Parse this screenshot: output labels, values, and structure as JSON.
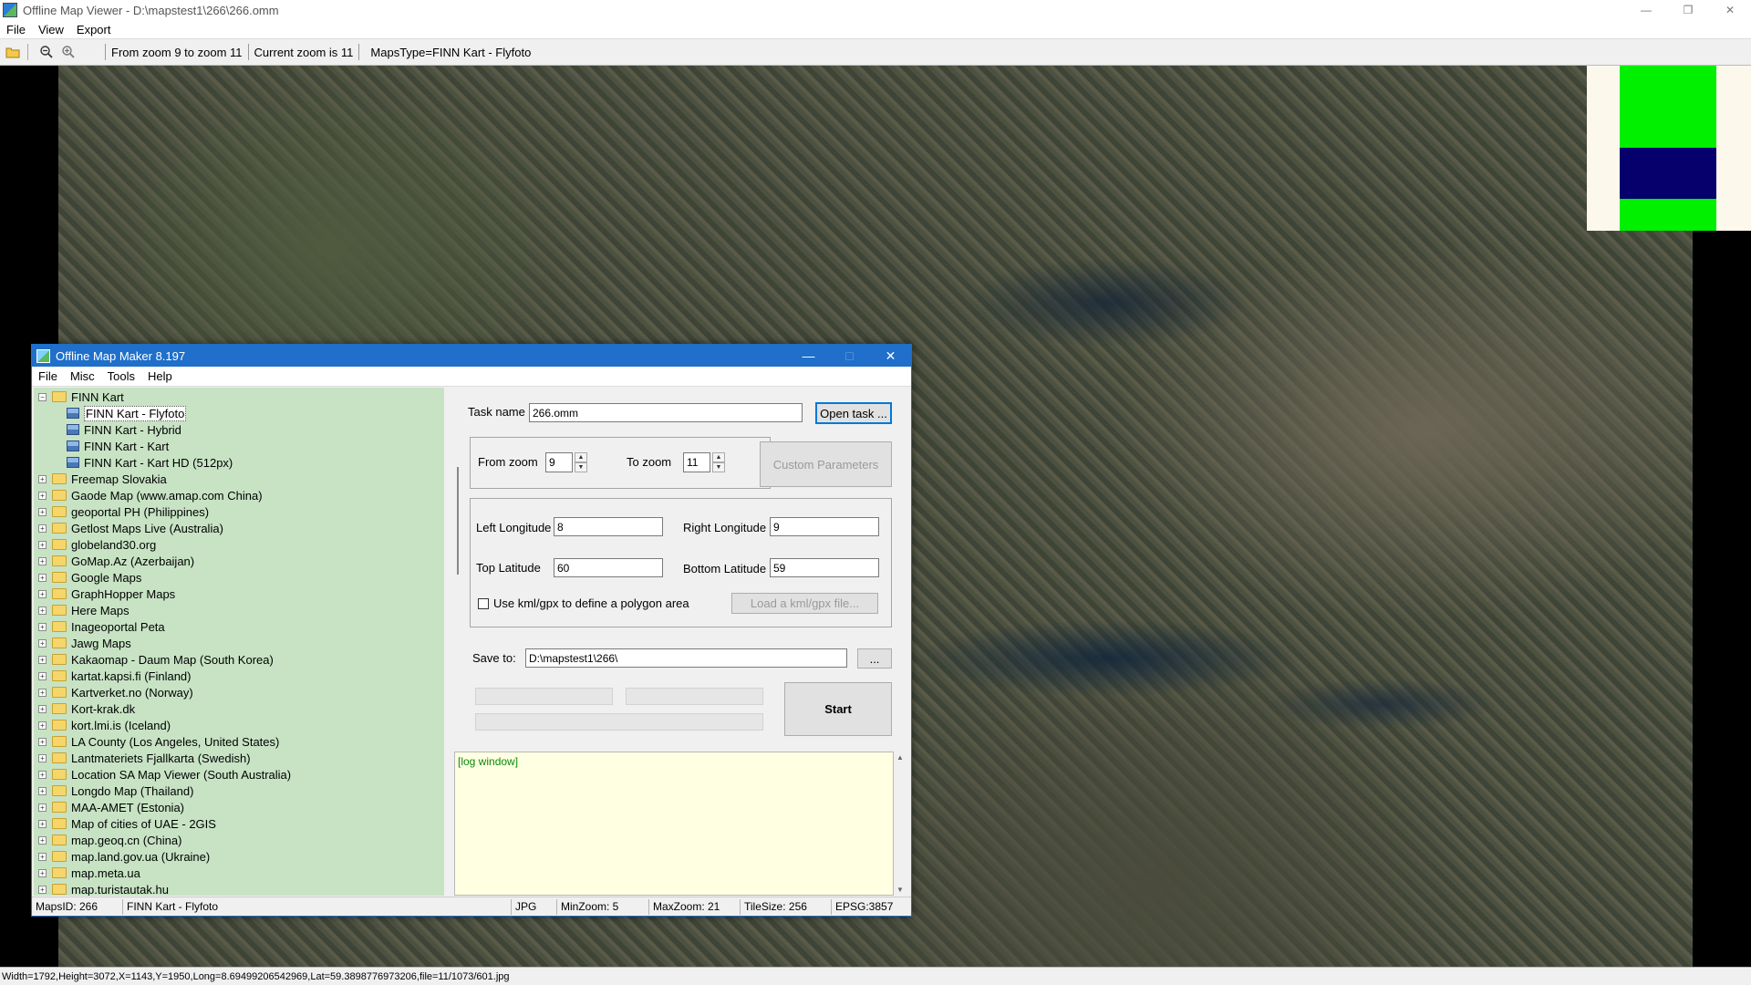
{
  "outer": {
    "title": "Offline Map Viewer - D:\\mapstest1\\266\\266.omm",
    "menu": [
      "File",
      "View",
      "Export"
    ],
    "toolbar": {
      "zoom_range": "From zoom 9 to zoom 11",
      "current_zoom": "Current zoom is 11",
      "maps_type": "MapsType=FINN Kart - Flyfoto"
    },
    "status": "Width=1792,Height=3072,X=1143,Y=1950,Long=8.69499206542969,Lat=59.3898776973206,file=11/1073/601.jpg"
  },
  "dialog": {
    "title": "Offline Map Maker 8.197",
    "menu": [
      "File",
      "Misc",
      "Tools",
      "Help"
    ],
    "tree": {
      "root": "FINN Kart",
      "children": [
        "FINN Kart - Flyfoto",
        "FINN Kart - Hybrid",
        "FINN Kart - Kart",
        "FINN Kart - Kart HD (512px)"
      ],
      "selected_child": "FINN Kart - Flyfoto",
      "folders": [
        "Freemap Slovakia",
        "Gaode Map (www.amap.com China)",
        "geoportal PH (Philippines)",
        "Getlost Maps Live (Australia)",
        "globeland30.org",
        "GoMap.Az (Azerbaijan)",
        "Google Maps",
        "GraphHopper Maps",
        "Here Maps",
        "Inageoportal Peta",
        "Jawg Maps",
        "Kakaomap - Daum Map (South Korea)",
        "kartat.kapsi.fi (Finland)",
        "Kartverket.no (Norway)",
        "Kort-krak.dk",
        "kort.lmi.is (Iceland)",
        "LA County (Los Angeles, United States)",
        "Lantmateriets Fjallkarta (Swedish)",
        "Location SA Map Viewer (South Australia)",
        "Longdo Map (Thailand)",
        "MAA-AMET (Estonia)",
        "Map of cities of UAE - 2GIS",
        "map.geoq.cn (China)",
        "map.land.gov.ua (Ukraine)",
        "map.meta.ua",
        "map.turistautak.hu"
      ]
    },
    "form": {
      "task_name_label": "Task name",
      "task_name_value": "266.omm",
      "open_task_btn": "Open task ...",
      "from_zoom_label": "From zoom",
      "from_zoom_value": "9",
      "to_zoom_label": "To zoom",
      "to_zoom_value": "11",
      "custom_params_btn": "Custom Parameters",
      "left_lon_label": "Left Longitude",
      "left_lon_value": "8",
      "right_lon_label": "Right Longitude",
      "right_lon_value": "9",
      "top_lat_label": "Top Latitude",
      "top_lat_value": "60",
      "bottom_lat_label": "Bottom Latitude",
      "bottom_lat_value": "59",
      "kml_checkbox_label": "Use kml/gpx to define a polygon area",
      "load_kml_btn": "Load a kml/gpx file...",
      "save_to_label": "Save to:",
      "save_to_value": "D:\\mapstest1\\266\\",
      "browse_btn": "...",
      "start_btn": "Start",
      "log_text": "[log window]"
    },
    "status": {
      "maps_id": "MapsID: 266",
      "maps_name": "FINN Kart - Flyfoto",
      "format": "JPG",
      "min_zoom": "MinZoom: 5",
      "max_zoom": "MaxZoom: 21",
      "tile_size": "TileSize: 256",
      "epsg": "EPSG:3857"
    }
  },
  "colors": {
    "dialog_titlebar": "#1f6fcb",
    "tree_bg": "#c7e3c4",
    "log_bg": "#ffffe2",
    "minimap_green": "#00f000",
    "minimap_blue": "#05006b"
  }
}
